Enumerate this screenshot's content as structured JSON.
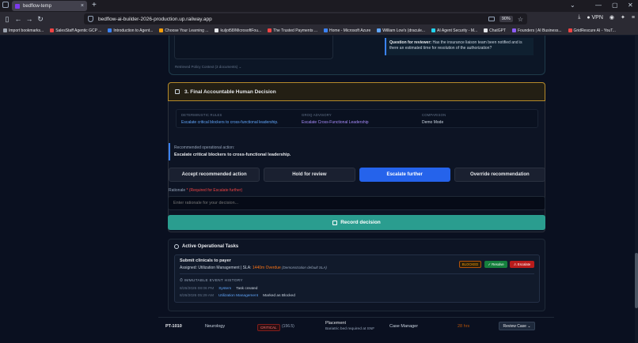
{
  "browser": {
    "tab_title": "bedflow-temp",
    "tab_close": "×",
    "new_tab": "+",
    "url": "bedflow-ai-builder-2026-production.up.railway.app",
    "zoom": "90%",
    "vpn_label": "VPN",
    "window_controls": [
      "⌄",
      "—",
      "▢",
      "✕"
    ],
    "bookmarks": [
      {
        "label": "Import bookmarks...",
        "color": "#9ca3af"
      },
      {
        "label": "SalesStaff Agentic GCP ...",
        "color": "#ef4444"
      },
      {
        "label": "Introduction to Agent...",
        "color": "#3b82f6"
      },
      {
        "label": "Choose Your Learning ...",
        "color": "#f59e0b"
      },
      {
        "label": "kuljot58/MicrosoftFou...",
        "color": "#e5e7eb"
      },
      {
        "label": "The Trusted Payments ...",
        "color": "#ef4444"
      },
      {
        "label": "Home - Microsoft Azure",
        "color": "#3b82f6"
      },
      {
        "label": "William Low's (dracule...",
        "color": "#60a5fa"
      },
      {
        "label": "AI Agent Security - M...",
        "color": "#22d3ee"
      },
      {
        "label": "ChatGPT",
        "color": "#e5e7eb"
      },
      {
        "label": "Founders | AI Business...",
        "color": "#8b5cf6"
      },
      {
        "label": "GridRescure AI - YouT...",
        "color": "#ef4444"
      }
    ]
  },
  "review": {
    "question_label": "Question for reviewer:",
    "question_text": "Has the insurance liaison team been notified and is there an estimated time for resolution of the authorization?",
    "policy_context": "Retrieved Policy Context (3 documents) ⌄"
  },
  "decision": {
    "header": "3. Final Accountable Human Decision",
    "rules": [
      {
        "label": "DETERMINISTIC RULES",
        "value": "Escalate critical blockers to cross-functional leadership."
      },
      {
        "label": "GROQ ADVISORY",
        "value": "Escalate Cross-Functional Leadership"
      },
      {
        "label": "COMPARISON",
        "value": "Demo Mode"
      }
    ],
    "recommended_label": "Recommended operational action:",
    "recommended_value": "Escalate critical blockers to cross-functional leadership.",
    "buttons": [
      "Accept recommended action",
      "Hold for review",
      "Escalate further",
      "Override recommendation"
    ],
    "rationale_label": "Rationale",
    "rationale_required": "* (Required for Escalate further)",
    "rationale_placeholder": "Enter rationale for your decision...",
    "record_label": "Record decision"
  },
  "tasks": {
    "title": "Active Operational Tasks",
    "task_name": "Submit clinicals to payer",
    "assigned": "Assigned: Utilization Management  |  SLA:",
    "overdue": "1440m Overdue",
    "demo_note": "(Demonstration default SLA)",
    "badges": {
      "blocked": "BLOCKED",
      "resolve": "✓ Resolve",
      "escalate": "⚠ Escalate"
    },
    "history_title": "⏱ IMMUTABLE EVENT HISTORY",
    "history": [
      {
        "time": "8/26/2026 08:06 PM",
        "actor": "System",
        "message": "Task created"
      },
      {
        "time": "8/26/2026 05:29 AM",
        "actor": "Utilization Management",
        "message": "Marked as Blocked"
      }
    ]
  },
  "table_row": {
    "id": "PT-1010",
    "service": "Neurology",
    "acuity": "CRITICAL",
    "score": "(156.5)",
    "placement": "Placement",
    "placement_detail": "Bariatric bed required at SNF",
    "owner": "Case Manager",
    "age": "28 hrs",
    "review_label": "Review Case ⌄"
  }
}
